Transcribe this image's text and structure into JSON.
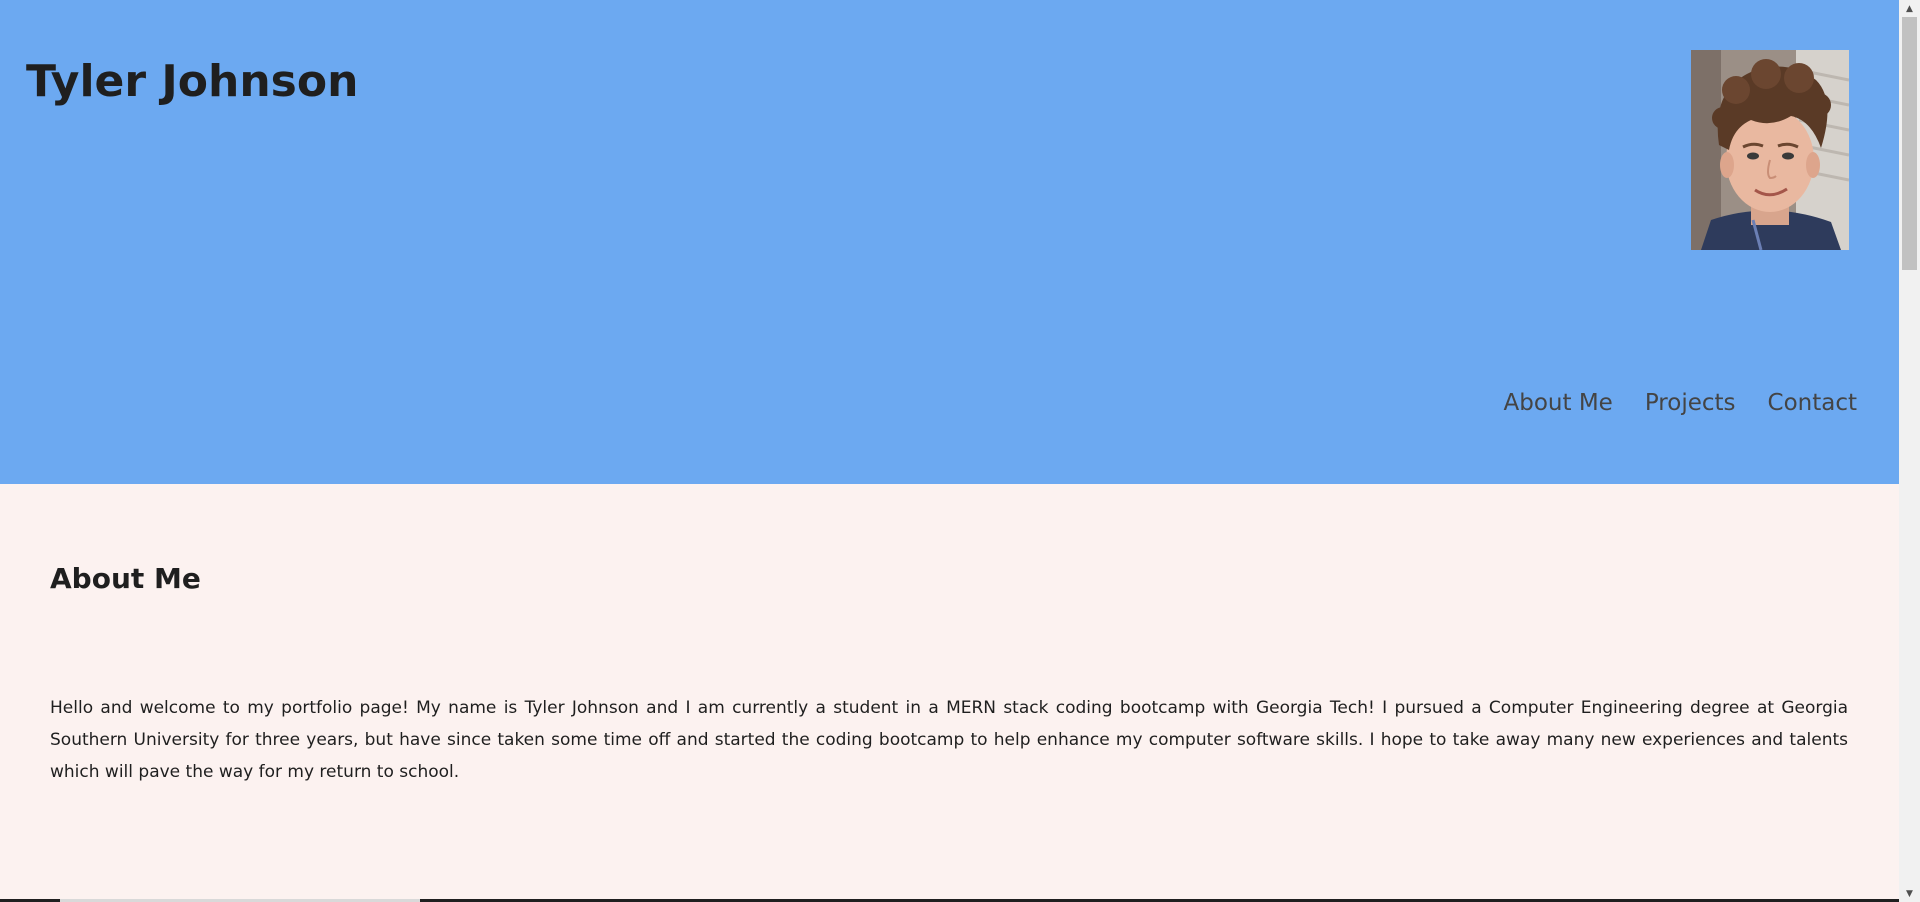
{
  "header": {
    "title": "Tyler Johnson",
    "background_color": "#6ca9f1",
    "avatar": {
      "icon": "profile-photo"
    },
    "nav": [
      {
        "label": "About Me"
      },
      {
        "label": "Projects"
      },
      {
        "label": "Contact"
      }
    ]
  },
  "about": {
    "heading": "About Me",
    "body": "Hello and welcome to my portfolio page! My name is Tyler Johnson and I am currently a student in a MERN stack coding bootcamp with Georgia Tech! I pursued a Computer Engineering degree at Georgia Southern University for three years, but have since taken some time off and started the coding bootcamp to help enhance my computer software skills. I hope to take away many new experiences and talents which will pave the way for my return to school.",
    "background_color": "#fcf2f0"
  },
  "scrollbar": {
    "up_icon": "scroll-up-arrow-icon",
    "down_icon": "scroll-down-arrow-icon"
  }
}
